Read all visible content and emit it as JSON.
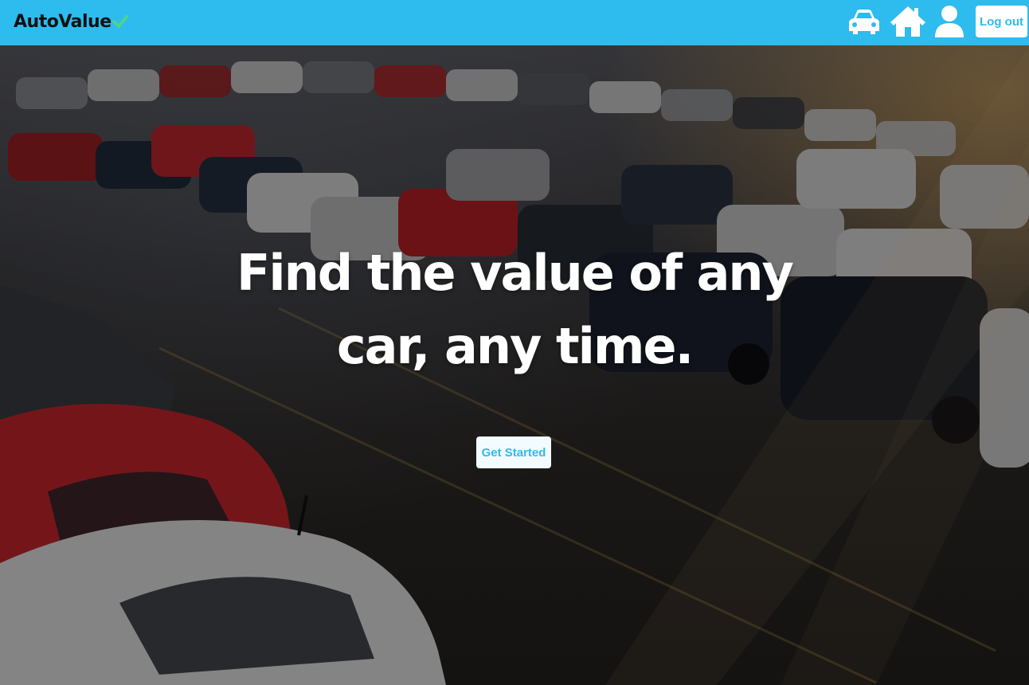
{
  "brand": {
    "name": "AutoValue",
    "accent_color": "#4fd58b"
  },
  "navbar": {
    "background_color": "#2ebbed",
    "icons": [
      "car-icon",
      "home-icon",
      "user-icon"
    ],
    "logout_label": "Log out"
  },
  "hero": {
    "headline_line1": "Find the value of any",
    "headline_line2": "car, any time.",
    "cta_label": "Get Started",
    "background": "parking-lot-of-cars-photo"
  }
}
